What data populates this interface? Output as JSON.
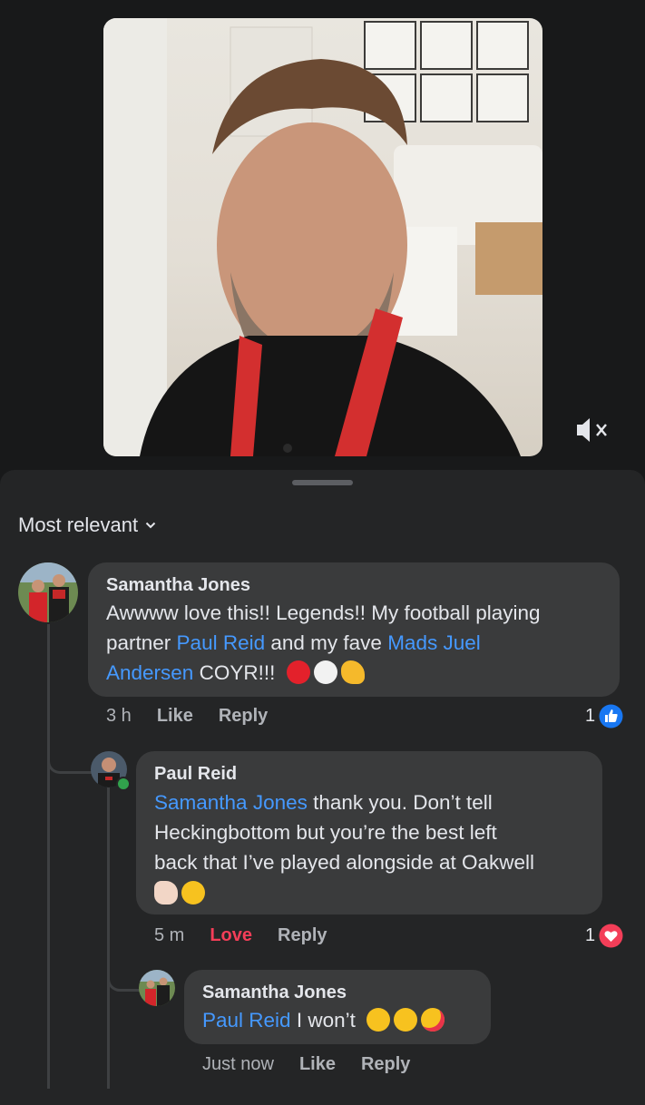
{
  "sort": {
    "label": "Most relevant"
  },
  "comments": [
    {
      "name": "Samantha Jones",
      "text_parts": [
        "Awwww love this!! Legends!! My football playing",
        "partner ",
        "Paul Reid",
        " and my fave ",
        "Mads Juel",
        "Andersen",
        " COYR!!!"
      ],
      "time": "3 h",
      "like": "Like",
      "reply": "Reply",
      "reaction_count": "1"
    },
    {
      "name": "Paul Reid",
      "text_parts": [
        "Samantha Jones",
        " thank you. Don’t tell",
        "Heckingbottom but you’re the best left",
        "back that I’ve played alongside at Oakwell"
      ],
      "time": "5 m",
      "like": "Love",
      "reply": "Reply",
      "reaction_count": "1"
    },
    {
      "name": "Samantha Jones",
      "text_parts": [
        "Paul Reid",
        " I won’t"
      ],
      "time": "Just now",
      "like": "Like",
      "reply": "Reply"
    }
  ],
  "colors": {
    "accent": "#4599ff",
    "love": "#f33e58",
    "like_badge": "#1877f2"
  },
  "icons": [
    "mute-icon",
    "chevron-down-icon",
    "like-reaction-icon",
    "love-reaction-icon"
  ]
}
